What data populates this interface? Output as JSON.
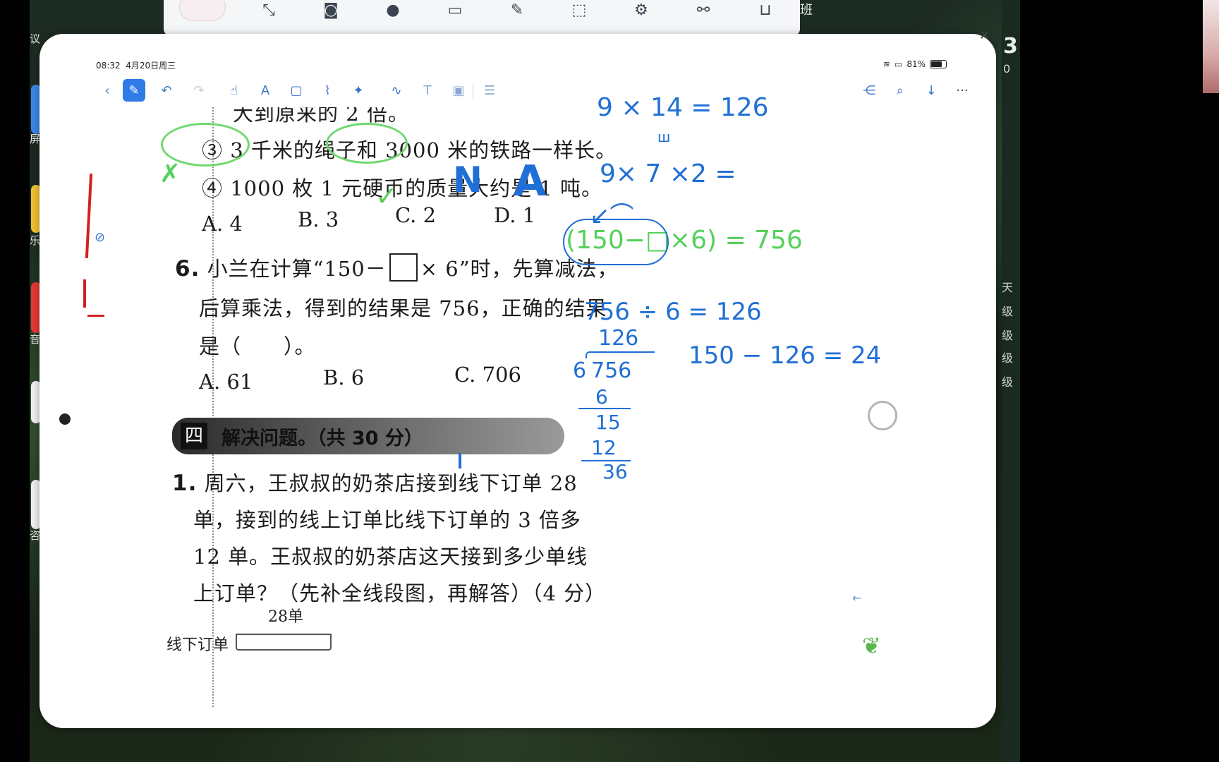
{
  "dock": {
    "icons": [
      "avatar-icon",
      "collapse-icon",
      "camera-icon",
      "record-icon",
      "screen-share-icon",
      "annotate-icon",
      "screenshot-icon",
      "settings-icon",
      "connect-icon",
      "cart-icon"
    ],
    "label": "班"
  },
  "desktop": {
    "right_big_number": "3",
    "right_number_2": "0",
    "left_fragments": [
      "议",
      "屏",
      "乐",
      "音",
      "咨"
    ],
    "right_fragments": [
      "天",
      "级",
      "级",
      "级",
      "级"
    ]
  },
  "status": {
    "time": "08:32",
    "date": "4月20日周三",
    "battery": "81%",
    "battery_level": 0.81
  },
  "toolbar": {
    "left_icons": [
      "back-icon",
      "pen-icon",
      "undo-icon",
      "redo-icon",
      "hand-icon",
      "highlighter-icon",
      "shape-icon",
      "lasso-icon",
      "magic-icon"
    ],
    "mid_icons": [
      "ink-icon",
      "text-box-icon",
      "image-icon",
      "template-icon"
    ],
    "right_icons": [
      "share-icon",
      "search-icon",
      "download-icon",
      "more-icon"
    ]
  },
  "worksheet": {
    "line_top": "大到原来的 2 倍。",
    "item3": "③ 3 千米的绳子和 3000 米的铁路一样长。",
    "item4": "④ 1000 枚 1 元硬币的质量大约是 1 吨。",
    "q5_options": [
      "A. 4",
      "B. 3",
      "C. 2",
      "D. 1"
    ],
    "q6_number": "6.",
    "q6_line1_a": "小兰在计算“150－",
    "q6_line1_b": "× 6”时，先算减法，",
    "q6_line2": "后算乘法，得到的结果是 756，正确的结果",
    "q6_line3": "是（　　）。",
    "q6_options": [
      "A. 61",
      "B. 6",
      "C. 706"
    ],
    "section_num": "四",
    "section_title": "解决问题。（共 30 分）",
    "p1_number": "1.",
    "p1_line1": "周六，王叔叔的奶茶店接到线下订单 28",
    "p1_line2": "单，接到的线上订单比线下订单的 3 倍多",
    "p1_line3": "12 单。王叔叔的奶茶店这天接到多少单线",
    "p1_line4": "上订单？（先补全线段图，再解答）（4 分）",
    "diagram_top": "28单",
    "diagram_row": "线下订单"
  },
  "handwriting": {
    "blue_1": "9 × 14 = 126",
    "blue_2": "9× 7 ×2 =",
    "green_1": "(150−□×6) = 756",
    "blue_3": "756 ÷ 6 = 126",
    "div_quotient": "126",
    "div_divisor": "6",
    "div_dividend": "756",
    "div_r1": "6",
    "div_r2": "15",
    "div_r3": "12",
    "div_r4": "36",
    "blue_4": "150 − 126 = 24",
    "answer_mark": "A",
    "mark_n": "N"
  }
}
